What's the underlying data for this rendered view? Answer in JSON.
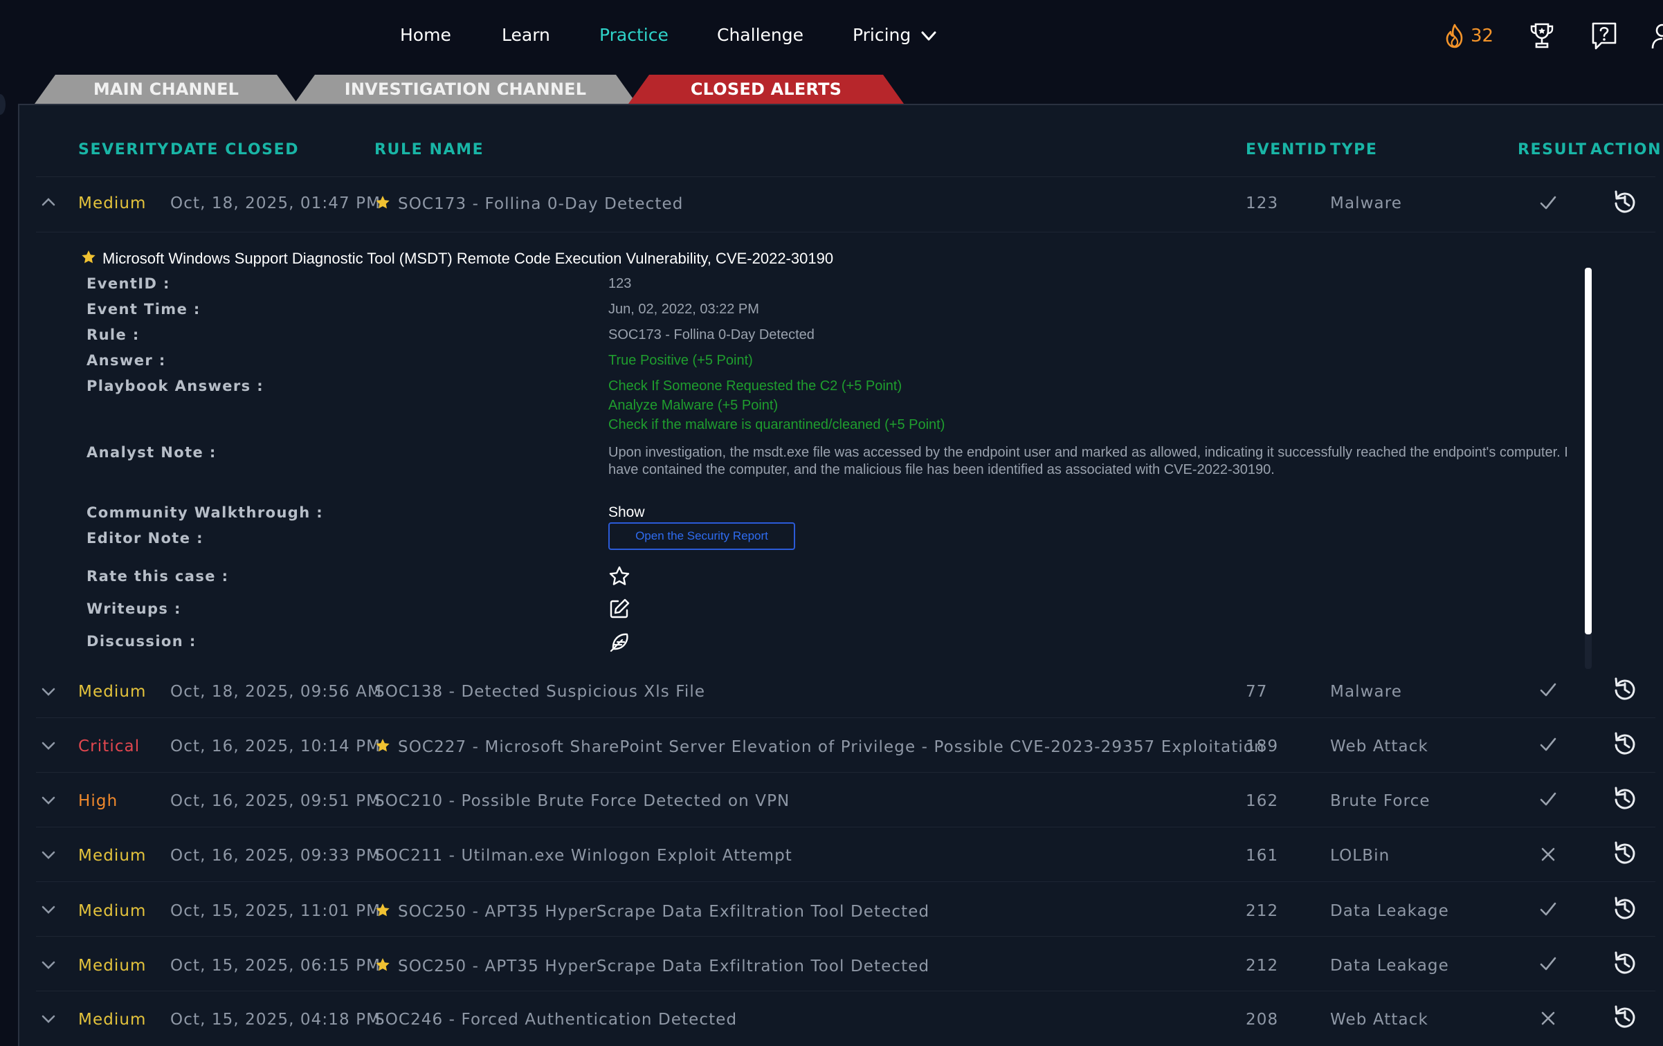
{
  "nav": {
    "items": [
      {
        "label": "Home",
        "active": false
      },
      {
        "label": "Learn",
        "active": false
      },
      {
        "label": "Practice",
        "active": true
      },
      {
        "label": "Challenge",
        "active": false
      },
      {
        "label": "Pricing",
        "active": false
      }
    ],
    "streak_count": "32",
    "icons": [
      "flame-icon",
      "trophy-icon",
      "help-icon",
      "user-icon",
      "chevron-down-icon"
    ]
  },
  "tabs": [
    {
      "label": "MAIN CHANNEL",
      "active": false
    },
    {
      "label": "INVESTIGATION CHANNEL",
      "active": false
    },
    {
      "label": "CLOSED ALERTS",
      "active": true
    }
  ],
  "colors": {
    "accent": "#2fd3c9",
    "header": "#19b5a6",
    "medium": "#e4c33c",
    "critical": "#e2474f",
    "high": "#f0892c",
    "answer_green": "#1f9e2e",
    "tab_active": "#b7262b"
  },
  "table": {
    "columns": [
      "SEVERITY",
      "DATE CLOSED",
      "RULE NAME",
      "EVENTID",
      "TYPE",
      "RESULT",
      "ACTION"
    ],
    "rows": [
      {
        "severity": "Medium",
        "date": "Oct, 18, 2025, 01:47 PM",
        "starred": true,
        "rule": "SOC173 - Follina 0-Day Detected",
        "eventid": "123",
        "type": "Malware",
        "result": "check",
        "expanded": true
      },
      {
        "severity": "Medium",
        "date": "Oct, 18, 2025, 09:56 AM",
        "starred": false,
        "rule": "SOC138 - Detected Suspicious Xls File",
        "eventid": "77",
        "type": "Malware",
        "result": "check",
        "expanded": false
      },
      {
        "severity": "Critical",
        "date": "Oct, 16, 2025, 10:14 PM",
        "starred": true,
        "rule": "SOC227 - Microsoft SharePoint Server Elevation of Privilege - Possible CVE-2023-29357 Exploitation",
        "eventid": "189",
        "type": "Web Attack",
        "result": "check",
        "expanded": false
      },
      {
        "severity": "High",
        "date": "Oct, 16, 2025, 09:51 PM",
        "starred": false,
        "rule": "SOC210 - Possible Brute Force Detected on VPN",
        "eventid": "162",
        "type": "Brute Force",
        "result": "check",
        "expanded": false
      },
      {
        "severity": "Medium",
        "date": "Oct, 16, 2025, 09:33 PM",
        "starred": false,
        "rule": "SOC211 - Utilman.exe Winlogon Exploit Attempt",
        "eventid": "161",
        "type": "LOLBin",
        "result": "cross",
        "expanded": false
      },
      {
        "severity": "Medium",
        "date": "Oct, 15, 2025, 11:01 PM",
        "starred": true,
        "rule": "SOC250 - APT35 HyperScrape Data Exfiltration Tool Detected",
        "eventid": "212",
        "type": "Data Leakage",
        "result": "check",
        "expanded": false
      },
      {
        "severity": "Medium",
        "date": "Oct, 15, 2025, 06:15 PM",
        "starred": true,
        "rule": "SOC250 - APT35 HyperScrape Data Exfiltration Tool Detected",
        "eventid": "212",
        "type": "Data Leakage",
        "result": "check",
        "expanded": false
      },
      {
        "severity": "Medium",
        "date": "Oct, 15, 2025, 04:18 PM",
        "starred": false,
        "rule": "SOC246 - Forced Authentication Detected",
        "eventid": "208",
        "type": "Web Attack",
        "result": "cross",
        "expanded": false
      }
    ]
  },
  "detail": {
    "title": "Microsoft Windows Support Diagnostic Tool (MSDT) Remote Code Execution Vulnerability, CVE-2022-30190",
    "labels": {
      "eventid": "EventID :",
      "event_time": "Event Time :",
      "rule": "Rule :",
      "answer": "Answer :",
      "playbook": "Playbook Answers :",
      "analyst_note": "Analyst Note :",
      "walkthrough": "Community Walkthrough :",
      "editor_note": "Editor Note :",
      "rate": "Rate this case :",
      "writeups": "Writeups :",
      "discussion": "Discussion :"
    },
    "eventid": "123",
    "event_time": "Jun, 02, 2022, 03:22 PM",
    "rule": "SOC173 - Follina 0-Day Detected",
    "answer": "True Positive (+5 Point)",
    "playbook_answers": [
      "Check If Someone Requested the C2 (+5 Point)",
      "Analyze Malware (+5 Point)",
      "Check if the malware is quarantined/cleaned (+5 Point)"
    ],
    "analyst_note": "Upon investigation, the msdt.exe file was accessed by the endpoint user and marked as allowed, indicating it successfully reached the endpoint's computer. I have contained the computer, and the malicious file has been identified as associated with CVE-2022-30190.",
    "walkthrough": "Show",
    "report_button": "Open the Security Report"
  }
}
